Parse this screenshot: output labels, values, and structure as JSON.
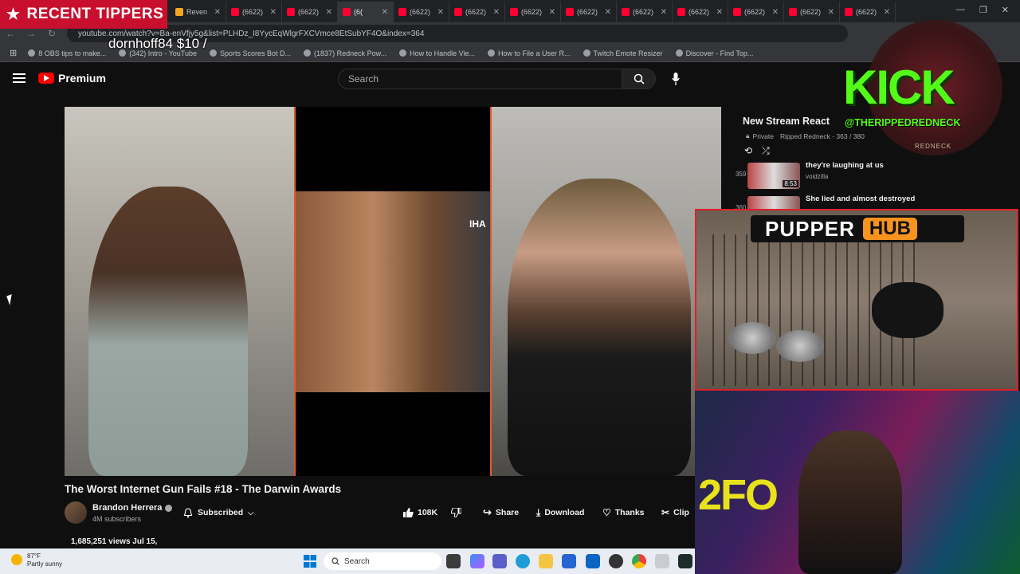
{
  "overlay": {
    "tippers_title": "RECENT TIPPERS",
    "tipper_line": "dornhoff84 $10 /",
    "kick_word": "KICK",
    "kick_handle": "@THERIPPEDREDNECK",
    "kick_sub": "REDNECK",
    "pupper_word": "PUPPER",
    "pupper_hub": "HUB",
    "webcam_sign": "2FO"
  },
  "browser": {
    "tabs": [
      {
        "label": "Reven",
        "active": false
      },
      {
        "label": "(6622)",
        "active": false
      },
      {
        "label": "(6622)",
        "active": false
      },
      {
        "label": "(6(",
        "active": true
      },
      {
        "label": "(6622)",
        "active": false
      },
      {
        "label": "(6622)",
        "active": false
      },
      {
        "label": "(6622)",
        "active": false
      },
      {
        "label": "(6622)",
        "active": false
      },
      {
        "label": "(6622)",
        "active": false
      },
      {
        "label": "(6622)",
        "active": false
      },
      {
        "label": "(6622)",
        "active": false
      },
      {
        "label": "(6622)",
        "active": false
      },
      {
        "label": "(6622)",
        "active": false
      }
    ],
    "url": "youtube.com/watch?v=Ba-enVfjy5g&list=PLHDz_I8YycEqWlgrFXCVmce8EtSubYF4O&index=364",
    "bookmarks": [
      "8 OBS tips to make...",
      "(342) Intro - YouTube",
      "Sports Scores Bot D...",
      "(1837) Redneck Pow...",
      "How to Handle Vie...",
      "How to File a User R...",
      "Twitch Emote Resizer",
      "Discover - Find Top..."
    ]
  },
  "youtube": {
    "logo_text": "Premium",
    "search_placeholder": "Search",
    "video_title": "The Worst Internet Gun Fails #18 - The Darwin Awards",
    "channel_name": "Brandon Herrera",
    "subscribers": "4M subscribers",
    "subscribed_label": "Subscribed",
    "likes": "108K",
    "share_label": "Share",
    "download_label": "Download",
    "thanks_label": "Thanks",
    "clip_label": "Clip",
    "views_date": "1,685,251 views  Jul 15,",
    "video_overlay_text": "IHA"
  },
  "playlist": {
    "title": "New Stream React",
    "privacy": "Private",
    "owner_progress": "Ripped Redneck - 363 / 380",
    "items": [
      {
        "index": "359",
        "title": "they're laughing at us",
        "channel": "voidzilla",
        "duration": "8:53"
      },
      {
        "index": "360",
        "title": "She lied and almost destroyed",
        "channel": "",
        "duration": ""
      }
    ]
  },
  "taskbar": {
    "temp": "87°F",
    "condition": "Partly sunny",
    "search_label": "Search"
  },
  "colors": {
    "youtube_red": "#ff0000",
    "kick_green": "#53fc18",
    "tippers_red": "#c8102e",
    "pupper_orange": "#f7931e"
  }
}
